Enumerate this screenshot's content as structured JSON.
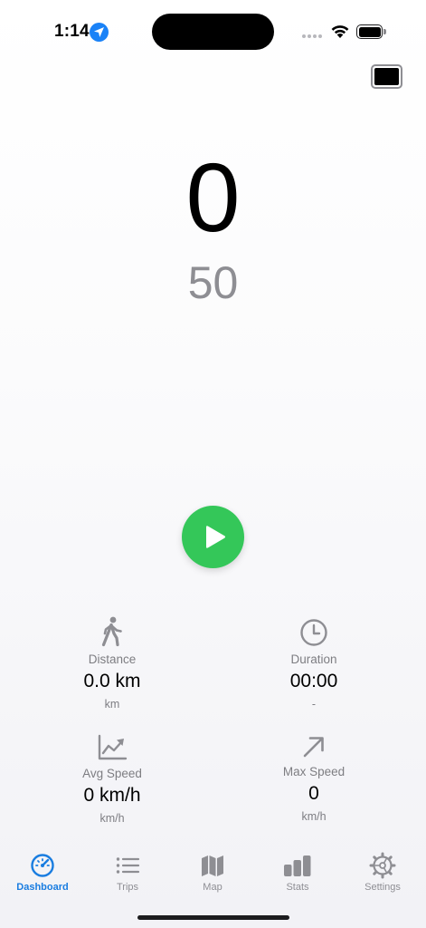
{
  "status_bar": {
    "time": "1:14",
    "icons": [
      "location-arrow-icon",
      "cellular-signal-icon",
      "wifi-icon",
      "battery-icon"
    ]
  },
  "speed": {
    "current": "0",
    "limit": "50"
  },
  "stats": {
    "distance": {
      "label": "Distance",
      "value": "0.0 km",
      "unit": "km",
      "icon": "walking-figure-icon"
    },
    "duration": {
      "label": "Duration",
      "value": "00:00",
      "unit": "-",
      "icon": "clock-icon"
    },
    "avg_speed": {
      "label": "Avg Speed",
      "value": "0 km/h",
      "unit": "km/h",
      "icon": "line-chart-icon"
    },
    "max_speed": {
      "label": "Max Speed",
      "value": "0",
      "unit": "km/h",
      "icon": "arrow-up-right-icon"
    }
  },
  "tabs": [
    {
      "label": "Dashboard",
      "icon": "speedometer-icon",
      "active": true
    },
    {
      "label": "Trips",
      "icon": "list-icon",
      "active": false
    },
    {
      "label": "Map",
      "icon": "map-icon",
      "active": false
    },
    {
      "label": "Stats",
      "icon": "bar-chart-icon",
      "active": false
    },
    {
      "label": "Settings",
      "icon": "gear-icon",
      "active": false
    }
  ],
  "colors": {
    "accent": "#1a7de0",
    "play": "#34c759",
    "secondary_text": "#8e8e93"
  }
}
